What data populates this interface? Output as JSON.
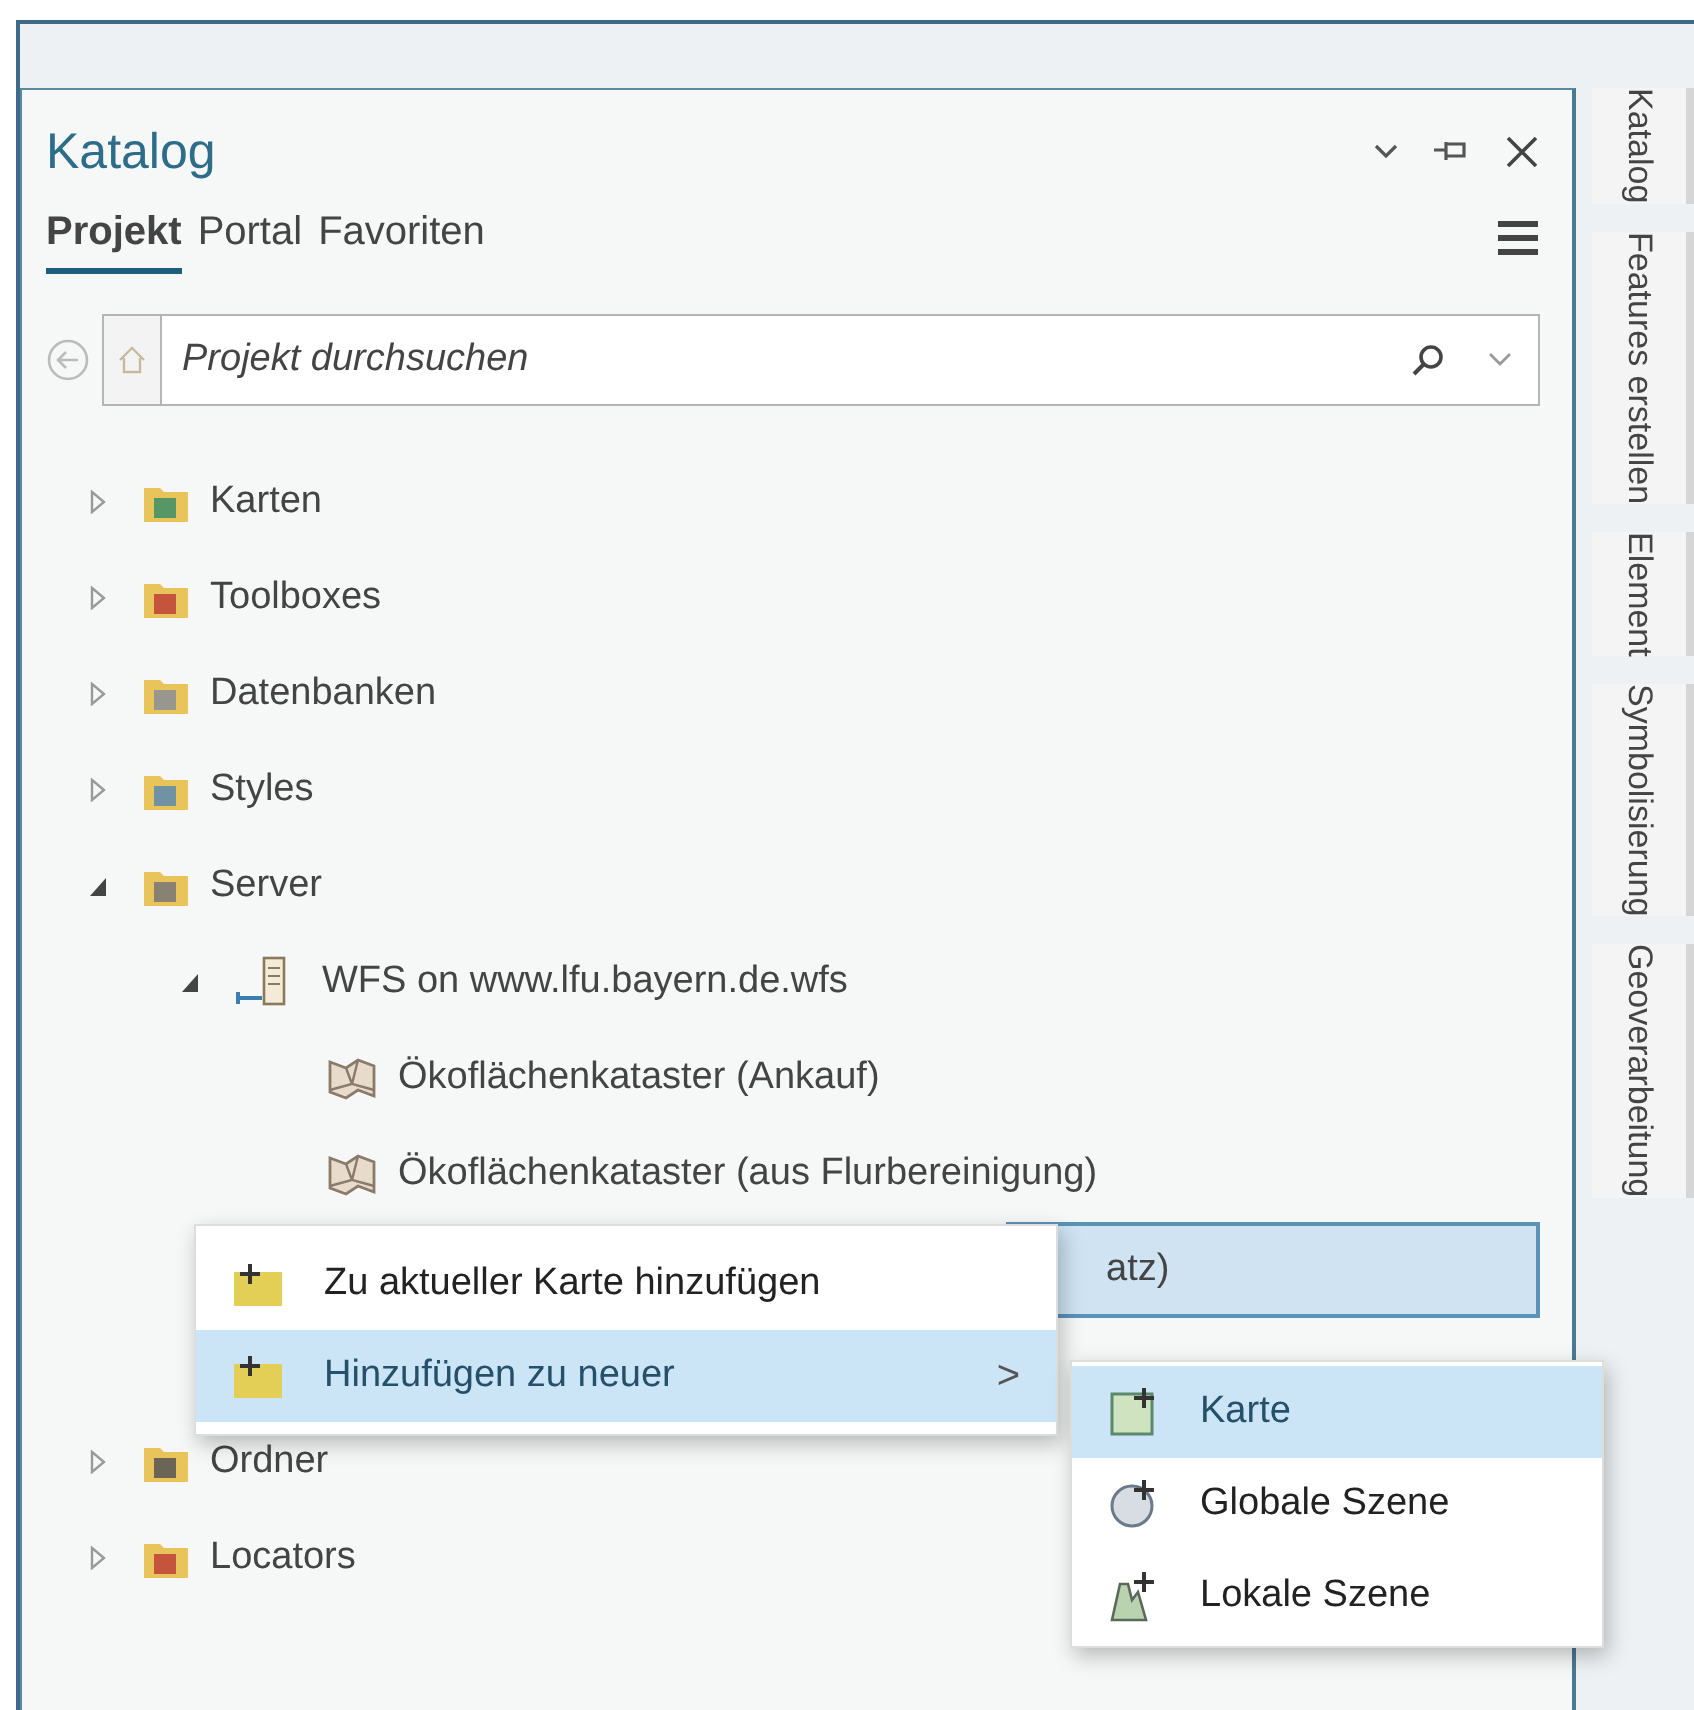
{
  "panel": {
    "title": "Katalog",
    "tabs": [
      {
        "label": "Projekt",
        "selected": true
      },
      {
        "label": "Portal",
        "selected": false
      },
      {
        "label": "Favoriten",
        "selected": false
      }
    ],
    "search": {
      "placeholder": "Projekt durchsuchen"
    },
    "tree": [
      {
        "label": "Karten",
        "kind": "maps",
        "expanded": false,
        "selected": false
      },
      {
        "label": "Toolboxes",
        "kind": "toolboxes",
        "expanded": false,
        "selected": false
      },
      {
        "label": "Datenbanken",
        "kind": "databases",
        "expanded": false,
        "selected": false
      },
      {
        "label": "Styles",
        "kind": "styles",
        "expanded": false,
        "selected": false
      },
      {
        "label": "Server",
        "kind": "servers",
        "expanded": true,
        "selected": false,
        "children": [
          {
            "label": "WFS on www.lfu.bayern.de.wfs",
            "kind": "service",
            "expanded": true,
            "selected": false,
            "children": [
              {
                "label": "Ökoflächenkataster (Ankauf)",
                "kind": "layer",
                "selected": false
              },
              {
                "label": "Ökoflächenkataster (aus Flurbereinigung)",
                "kind": "layer",
                "selected": false
              },
              {
                "label": "atz)",
                "kind": "covered",
                "selected": true
              }
            ]
          }
        ]
      },
      {
        "label": "Ordner",
        "kind": "folders",
        "expanded": false,
        "selected": false
      },
      {
        "label": "Locators",
        "kind": "locators",
        "expanded": false,
        "selected": false
      }
    ]
  },
  "context_menu": [
    {
      "label": "Zu aktueller Karte hinzufügen",
      "selected": false
    },
    {
      "label": "Hinzufügen zu neuer",
      "selected": true,
      "submenu_glyph": ">"
    }
  ],
  "submenu": [
    {
      "label": "Karte",
      "kind": "map",
      "selected": true
    },
    {
      "label": "Globale Szene",
      "kind": "globe",
      "selected": false
    },
    {
      "label": "Lokale Szene",
      "kind": "local",
      "selected": false
    }
  ],
  "side_tabs": [
    {
      "label": "Katalog"
    },
    {
      "label": "Features erstellen"
    },
    {
      "label": "Element"
    },
    {
      "label": "Symbolisierung"
    },
    {
      "label": "Geoverarbeitung"
    }
  ]
}
